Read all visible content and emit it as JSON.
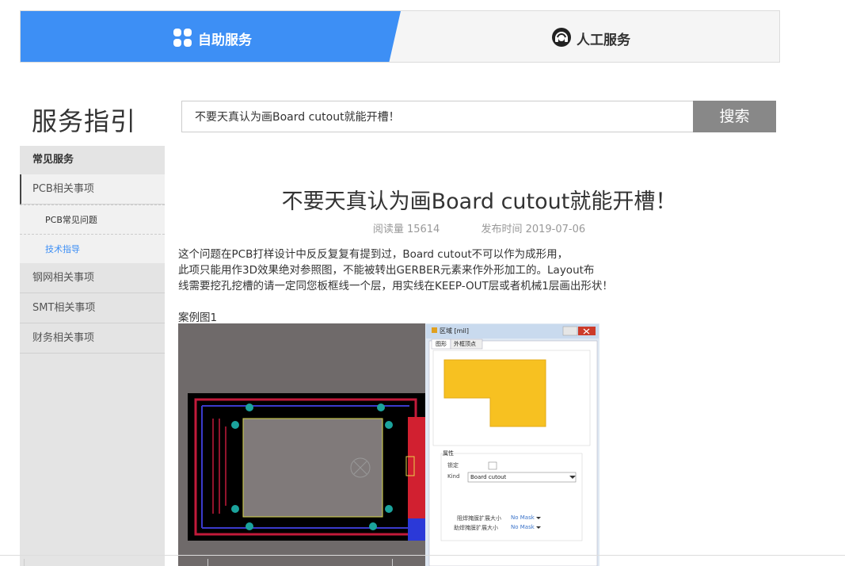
{
  "tabs": {
    "self_service": "自助服务",
    "human_service": "人工服务"
  },
  "guide_title": "服务指引",
  "search": {
    "value": "不要天真认为画Board cutout就能开槽！",
    "button": "搜索"
  },
  "sidebar": {
    "heading": "常见服务",
    "categories": [
      {
        "label": "PCB相关事项"
      },
      {
        "label": "钢网相关事项"
      },
      {
        "label": "SMT相关事项"
      },
      {
        "label": "财务相关事项"
      }
    ],
    "subitems": [
      {
        "label": "PCB常见问题"
      },
      {
        "label": "技术指导"
      }
    ]
  },
  "article": {
    "title": "不要天真认为画Board cutout就能开槽！",
    "reads": "阅读量 15614",
    "published": "发布时间 2019-07-06",
    "lines": [
      "这个问题在PCB打样设计中反反复复有提到过，Board cutout不可以作为成形用，",
      "此项只能用作3D效果绝对参照图，不能被转出GERBER元素来作外形加工的。Layout布",
      "线需要挖孔挖槽的请一定同您板框线一个层，用实线在KEEP-OUT层或者机械1层画出形状！"
    ],
    "figure_caption": "案例图1"
  },
  "dialog": {
    "title": "区域 [mil]",
    "tab_shape": "图形",
    "tab_outline": "外框顶点",
    "props_label": "属性",
    "lock_label": "锁定",
    "kind_label": "Kind",
    "kind_value": "Board cutout",
    "solder_label": "阻焊掩膜扩展大小",
    "solder_value": "No Mask",
    "paste_label": "助焊掩膜扩展大小",
    "paste_value": "No Mask"
  },
  "colors": {
    "accent": "#3d8ff5",
    "button_gray": "#888888",
    "sidebar_bg": "#e4e4e4"
  }
}
